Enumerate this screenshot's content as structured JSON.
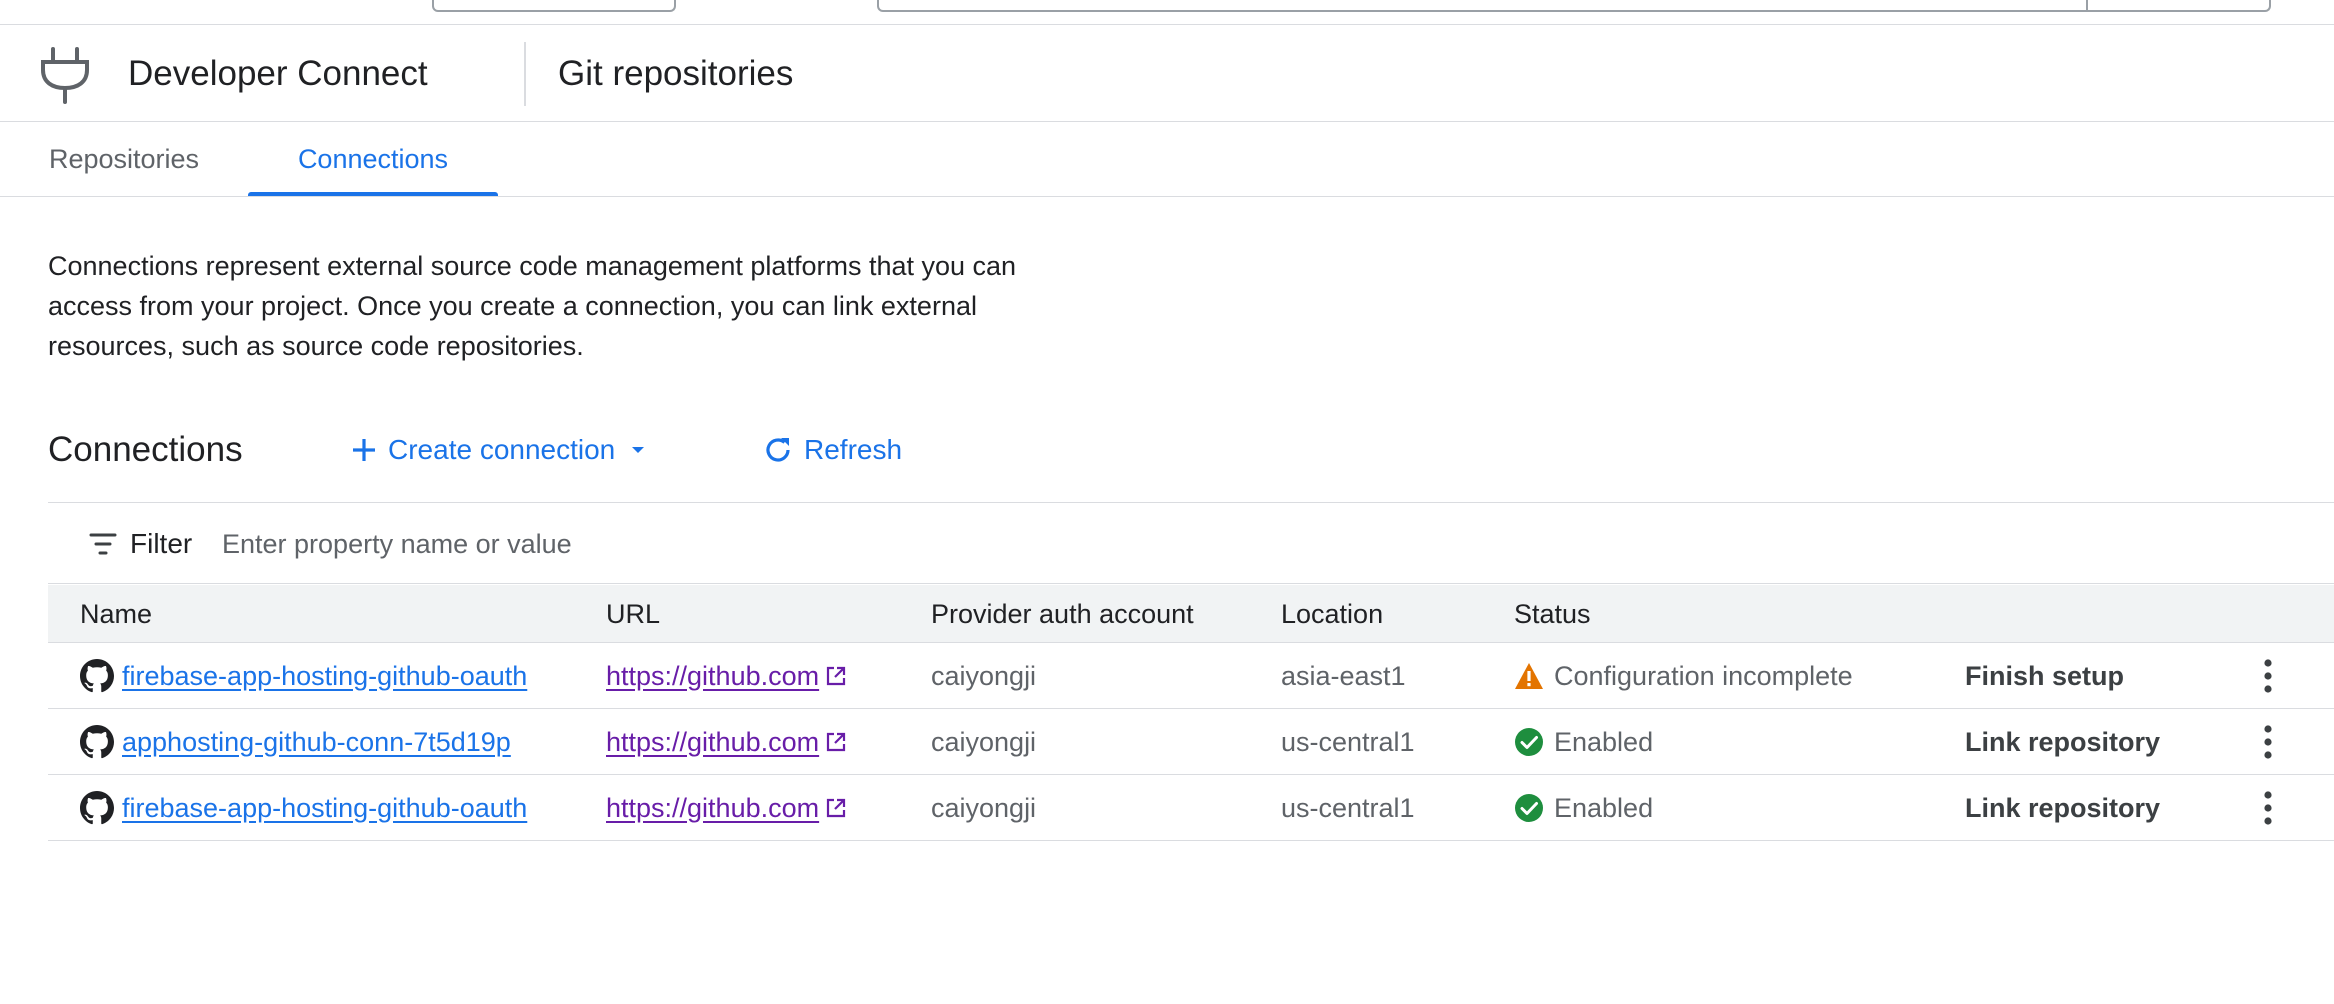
{
  "header": {
    "product_name": "Developer Connect",
    "page_name": "Git repositories"
  },
  "tabs": [
    {
      "label": "Repositories",
      "active": false
    },
    {
      "label": "Connections",
      "active": true
    }
  ],
  "description": "Connections represent external source code management platforms that you can access from your project. Once you create a connection, you can link external resources, such as source code repositories.",
  "toolbar": {
    "title": "Connections",
    "create_label": "Create connection",
    "refresh_label": "Refresh"
  },
  "filter": {
    "label": "Filter",
    "placeholder": "Enter property name or value"
  },
  "table": {
    "columns": [
      "Name",
      "URL",
      "Provider auth account",
      "Location",
      "Status"
    ],
    "rows": [
      {
        "name": "firebase-app-hosting-github-oauth",
        "url": "https://github.com",
        "account": "caiyongji",
        "location": "asia-east1",
        "status": "Configuration incomplete",
        "status_icon": "warning-icon",
        "action": "Finish setup"
      },
      {
        "name": "apphosting-github-conn-7t5d19p",
        "url": "https://github.com",
        "account": "caiyongji",
        "location": "us-central1",
        "status": "Enabled",
        "status_icon": "check-circle-icon",
        "action": "Link repository"
      },
      {
        "name": "firebase-app-hosting-github-oauth",
        "url": "https://github.com",
        "account": "caiyongji",
        "location": "us-central1",
        "status": "Enabled",
        "status_icon": "check-circle-icon",
        "action": "Link repository"
      }
    ]
  },
  "colors": {
    "accent": "#1a73e8",
    "visited_link": "#681da8",
    "warning": "#e37400",
    "success": "#1e8e3e"
  }
}
